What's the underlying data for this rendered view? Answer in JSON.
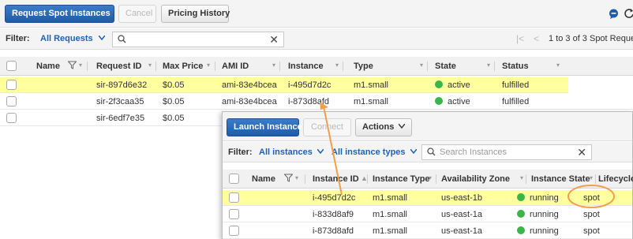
{
  "toolbar": {
    "request_spot_label": "Request Spot Instances",
    "cancel_label": "Cancel",
    "pricing_history_label": "Pricing History"
  },
  "filter": {
    "label": "Filter:",
    "value": "All Requests",
    "pagination": "1 to 3 of 3 Spot Reque"
  },
  "spot_table": {
    "columns": [
      "Name",
      "Request ID",
      "Max Price",
      "AMI ID",
      "Instance",
      "Type",
      "State",
      "Status"
    ],
    "rows": [
      {
        "request_id": "sir-897d6e32",
        "max_price": "$0.05",
        "ami_id": "ami-83e4bcea",
        "instance": "i-495d7d2c",
        "type": "m1.small",
        "state": "active",
        "status": "fulfilled"
      },
      {
        "request_id": "sir-2f3caa35",
        "max_price": "$0.05",
        "ami_id": "ami-83e4bcea",
        "instance": "i-873d8afd",
        "type": "m1.small",
        "state": "active",
        "status": "fulfilled"
      },
      {
        "request_id": "sir-6edf7e35",
        "max_price": "$0.05"
      }
    ]
  },
  "instances": {
    "launch_label": "Launch Instance",
    "connect_label": "Connect",
    "actions_label": "Actions",
    "filter_label": "Filter:",
    "filter_instances": "All instances",
    "filter_types": "All instance types",
    "search_placeholder": "Search Instances",
    "columns": [
      "Name",
      "Instance ID",
      "Instance Type",
      "Availability Zone",
      "Instance State",
      "Lifecycle"
    ],
    "rows": [
      {
        "instance_id": "i-495d7d2c",
        "type": "m1.small",
        "zone": "us-east-1b",
        "state": "running",
        "lifecycle": "spot"
      },
      {
        "instance_id": "i-833d8af9",
        "type": "m1.small",
        "zone": "us-east-1a",
        "state": "running",
        "lifecycle": "spot"
      },
      {
        "instance_id": "i-873d8afd",
        "type": "m1.small",
        "zone": "us-east-1a",
        "state": "running",
        "lifecycle": "spot"
      }
    ]
  },
  "colors": {
    "primary": "#1f5ca6",
    "highlight": "#ffffa0",
    "running": "#39b54a",
    "annotation": "#f0a04b",
    "link": "#1e62b4"
  },
  "icons": [
    "comment-icon",
    "refresh-icon",
    "search-icon",
    "filter-icon",
    "clear-icon",
    "chevron-down-icon",
    "sort-asc-icon",
    "page-first-icon",
    "page-prev-icon"
  ]
}
